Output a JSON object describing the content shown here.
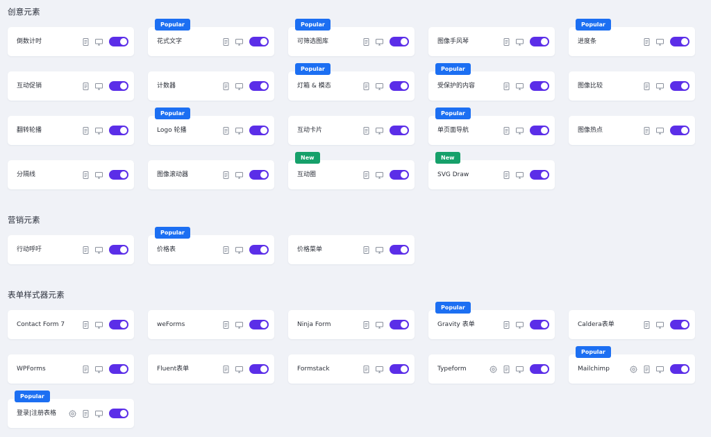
{
  "colors": {
    "toggle_on": "#5b2ee8",
    "badge_popular": "#1c6ff2",
    "badge_new": "#16a06a",
    "background": "#f0f2f7"
  },
  "sections": [
    {
      "title": "创意元素",
      "items": [
        {
          "label": "倒数计时",
          "badge": "",
          "badge_type": "",
          "gear": false,
          "enabled": true
        },
        {
          "label": "花式文字",
          "badge": "Popular",
          "badge_type": "popular",
          "gear": false,
          "enabled": true
        },
        {
          "label": "可筛选图库",
          "badge": "Popular",
          "badge_type": "popular",
          "gear": false,
          "enabled": true
        },
        {
          "label": "图像手风琴",
          "badge": "",
          "badge_type": "",
          "gear": false,
          "enabled": true
        },
        {
          "label": "进度条",
          "badge": "Popular",
          "badge_type": "popular",
          "gear": false,
          "enabled": true
        },
        {
          "label": "互动促销",
          "badge": "",
          "badge_type": "",
          "gear": false,
          "enabled": true
        },
        {
          "label": "计数器",
          "badge": "",
          "badge_type": "",
          "gear": false,
          "enabled": true
        },
        {
          "label": "灯箱 & 模态",
          "badge": "Popular",
          "badge_type": "popular",
          "gear": false,
          "enabled": true
        },
        {
          "label": "受保护的内容",
          "badge": "Popular",
          "badge_type": "popular",
          "gear": false,
          "enabled": true
        },
        {
          "label": "图像比较",
          "badge": "",
          "badge_type": "",
          "gear": false,
          "enabled": true
        },
        {
          "label": "翻转轮播",
          "badge": "",
          "badge_type": "",
          "gear": false,
          "enabled": true
        },
        {
          "label": "Logo 轮播",
          "badge": "Popular",
          "badge_type": "popular",
          "gear": false,
          "enabled": true
        },
        {
          "label": "互动卡片",
          "badge": "",
          "badge_type": "",
          "gear": false,
          "enabled": true
        },
        {
          "label": "单页面导航",
          "badge": "Popular",
          "badge_type": "popular",
          "gear": false,
          "enabled": true
        },
        {
          "label": "图像热点",
          "badge": "",
          "badge_type": "",
          "gear": false,
          "enabled": true
        },
        {
          "label": "分隔线",
          "badge": "",
          "badge_type": "",
          "gear": false,
          "enabled": true
        },
        {
          "label": "图像滚动器",
          "badge": "",
          "badge_type": "",
          "gear": false,
          "enabled": true
        },
        {
          "label": "互动圈",
          "badge": "New",
          "badge_type": "new",
          "gear": false,
          "enabled": true
        },
        {
          "label": "SVG Draw",
          "badge": "New",
          "badge_type": "new",
          "gear": false,
          "enabled": true
        }
      ]
    },
    {
      "title": "营销元素",
      "items": [
        {
          "label": "行动呼吁",
          "badge": "",
          "badge_type": "",
          "gear": false,
          "enabled": true
        },
        {
          "label": "价格表",
          "badge": "Popular",
          "badge_type": "popular",
          "gear": false,
          "enabled": true
        },
        {
          "label": "价格菜单",
          "badge": "",
          "badge_type": "",
          "gear": false,
          "enabled": true
        }
      ]
    },
    {
      "title": "表单样式器元素",
      "items": [
        {
          "label": "Contact Form 7",
          "badge": "",
          "badge_type": "",
          "gear": false,
          "enabled": true
        },
        {
          "label": "weForms",
          "badge": "",
          "badge_type": "",
          "gear": false,
          "enabled": true
        },
        {
          "label": "Ninja Form",
          "badge": "",
          "badge_type": "",
          "gear": false,
          "enabled": true
        },
        {
          "label": "Gravity 表单",
          "badge": "Popular",
          "badge_type": "popular",
          "gear": false,
          "enabled": true
        },
        {
          "label": "Caldera表单",
          "badge": "",
          "badge_type": "",
          "gear": false,
          "enabled": true
        },
        {
          "label": "WPForms",
          "badge": "",
          "badge_type": "",
          "gear": false,
          "enabled": true
        },
        {
          "label": "Fluent表单",
          "badge": "",
          "badge_type": "",
          "gear": false,
          "enabled": true
        },
        {
          "label": "Formstack",
          "badge": "",
          "badge_type": "",
          "gear": false,
          "enabled": true
        },
        {
          "label": "Typeform",
          "badge": "",
          "badge_type": "",
          "gear": true,
          "enabled": true
        },
        {
          "label": "Mailchimp",
          "badge": "Popular",
          "badge_type": "popular",
          "gear": true,
          "enabled": true
        },
        {
          "label": "登录|注册表格",
          "badge": "Popular",
          "badge_type": "popular",
          "gear": true,
          "enabled": true
        }
      ]
    }
  ]
}
